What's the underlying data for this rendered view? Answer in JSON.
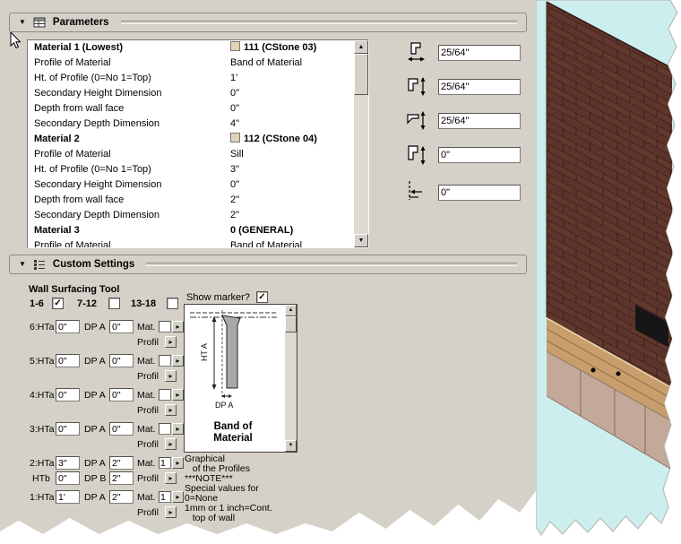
{
  "icons": {
    "collapse": "▼",
    "scroll_up": "▲",
    "scroll_down": "▼",
    "flyout": "▸"
  },
  "colors": {
    "dialog_bg": "#d5d1c8",
    "render_bg": "#cdeeee",
    "brick": "#5d342b",
    "band": "#c89e6c",
    "stone": "#c2a99a"
  },
  "parameters": {
    "title": "Parameters",
    "rows": [
      {
        "label": "Material 1 (Lowest)",
        "value": "111 (CStone 03)"
      },
      {
        "label": "Profile of Material",
        "value": "Band of Material"
      },
      {
        "label": "Ht. of Profile (0=No 1=Top)",
        "value": "1'"
      },
      {
        "label": "Secondary Height Dimension",
        "value": "0\""
      },
      {
        "label": "Depth from wall face",
        "value": "0\""
      },
      {
        "label": "Secondary Depth Dimension",
        "value": "4\""
      },
      {
        "label": "Material 2",
        "value": "112 (CStone 04)"
      },
      {
        "label": "Profile of Material",
        "value": "Sill"
      },
      {
        "label": "Ht. of Profile (0=No 1=Top)",
        "value": "3\""
      },
      {
        "label": "Secondary Height Dimension",
        "value": "0\""
      },
      {
        "label": "Depth from wall face",
        "value": "2\""
      },
      {
        "label": "Secondary Depth Dimension",
        "value": "2\""
      },
      {
        "label": "Material 3",
        "value": "0 (GENERAL)"
      },
      {
        "label": "Profile of Material",
        "value": "Band of Material"
      }
    ]
  },
  "dims": [
    "25/64\"",
    "25/64\"",
    "25/64\"",
    "0\"",
    "0\""
  ],
  "custom": {
    "title": "Custom Settings",
    "tool_title": "Wall Surfacing Tool",
    "mat_label": "Mat.",
    "profil_label": "Profil",
    "ranges": [
      {
        "label": "1-6",
        "check": "✓"
      },
      {
        "label": "7-12",
        "check": ""
      },
      {
        "label": "13-18",
        "check": ""
      }
    ],
    "rows": [
      {
        "n": "6:HTa",
        "ht": "0\"",
        "dpl": "DP A",
        "dp": "0\"",
        "mat": ""
      },
      {
        "n": "5:HTa",
        "ht": "0\"",
        "dpl": "DP A",
        "dp": "0\"",
        "mat": ""
      },
      {
        "n": "4:HTa",
        "ht": "0\"",
        "dpl": "DP A",
        "dp": "0\"",
        "mat": ""
      },
      {
        "n": "3:HTa",
        "ht": "0\"",
        "dpl": "DP A",
        "dp": "0\"",
        "mat": ""
      },
      {
        "n": "2:HTa",
        "ht": "3\"",
        "dpl": "DP A",
        "dp": "2\"",
        "mat": "1"
      },
      {
        "n": "1:HTa",
        "ht": "1'",
        "dpl": "DP A",
        "dp": "2\"",
        "mat": "1"
      }
    ],
    "row2b": {
      "n": "HTb",
      "ht": "0\"",
      "dpl": "DP B",
      "dp": "2\""
    },
    "marker": {
      "label": "Show marker?",
      "check": "✓"
    },
    "preview": {
      "ht_axis": "HT A",
      "dp_axis": "DP A",
      "caption_1": "Band of",
      "caption_2": "Material"
    },
    "notes": [
      "Graphical",
      "   of the Profiles",
      "***NOTE***",
      "Special values for",
      "0=None",
      "1mm or 1 inch=Cont.",
      "   top of wall"
    ]
  }
}
